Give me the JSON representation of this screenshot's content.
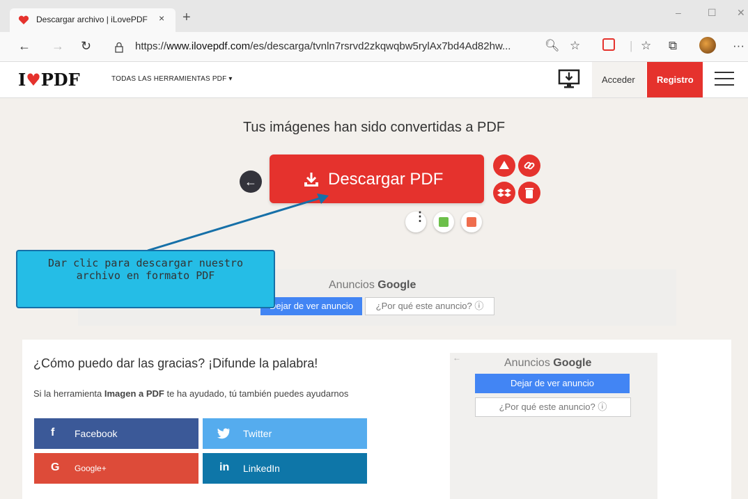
{
  "browser": {
    "tab_title": "Descargar archivo | iLovePDF",
    "tab_close": "×",
    "new_tab": "+",
    "url_prefix": "https://",
    "url_host": "www.ilovepdf.com",
    "url_path": "/es/descarga/tvnln7rsrvd2zkqwqbw5rylAx7bd4Ad82hw...",
    "window_controls": [
      "–",
      "☐",
      "✕"
    ]
  },
  "header": {
    "logo": "I♥PDF",
    "tools_menu": "TODAS LAS HERRAMIENTAS PDF ▾",
    "login": "Acceder",
    "register": "Registro"
  },
  "main": {
    "title": "Tus imágenes han sido convertidas a PDF",
    "download_label": "Descargar PDF"
  },
  "callout": {
    "line1": "Dar clic para descargar nuestro",
    "line2": "archivo en formato PDF"
  },
  "ad_top": {
    "label_prefix": "Anuncios ",
    "label_brand": "Google",
    "stop": "Dejar de ver anuncio",
    "why": "¿Por qué este anuncio? ⓘ"
  },
  "share": {
    "title": "¿Cómo puedo dar las gracias? ¡Difunde la palabra!",
    "desc_before": "Si la herramienta ",
    "desc_bold": "Imagen a PDF",
    "desc_after": " te ha ayudado, tú también puedes ayudarnos",
    "buttons": [
      {
        "label": "Facebook",
        "icon": "f",
        "color": "#3b5998"
      },
      {
        "label": "Twitter",
        "icon": "🐦",
        "color": "#55acee"
      },
      {
        "label": "Google+",
        "icon": "G",
        "color": "#dd4b39"
      },
      {
        "label": "LinkedIn",
        "icon": "in",
        "color": "#0e76a8"
      }
    ]
  },
  "ad_side": {
    "back_arrow": "←",
    "label_prefix": "Anuncios ",
    "label_brand": "Google",
    "stop": "Dejar de ver anuncio",
    "why": "¿Por qué este anuncio? ⓘ"
  },
  "colors": {
    "brand_red": "#e5322d",
    "callout": "#25bde6",
    "ad_blue": "#4285f4"
  }
}
